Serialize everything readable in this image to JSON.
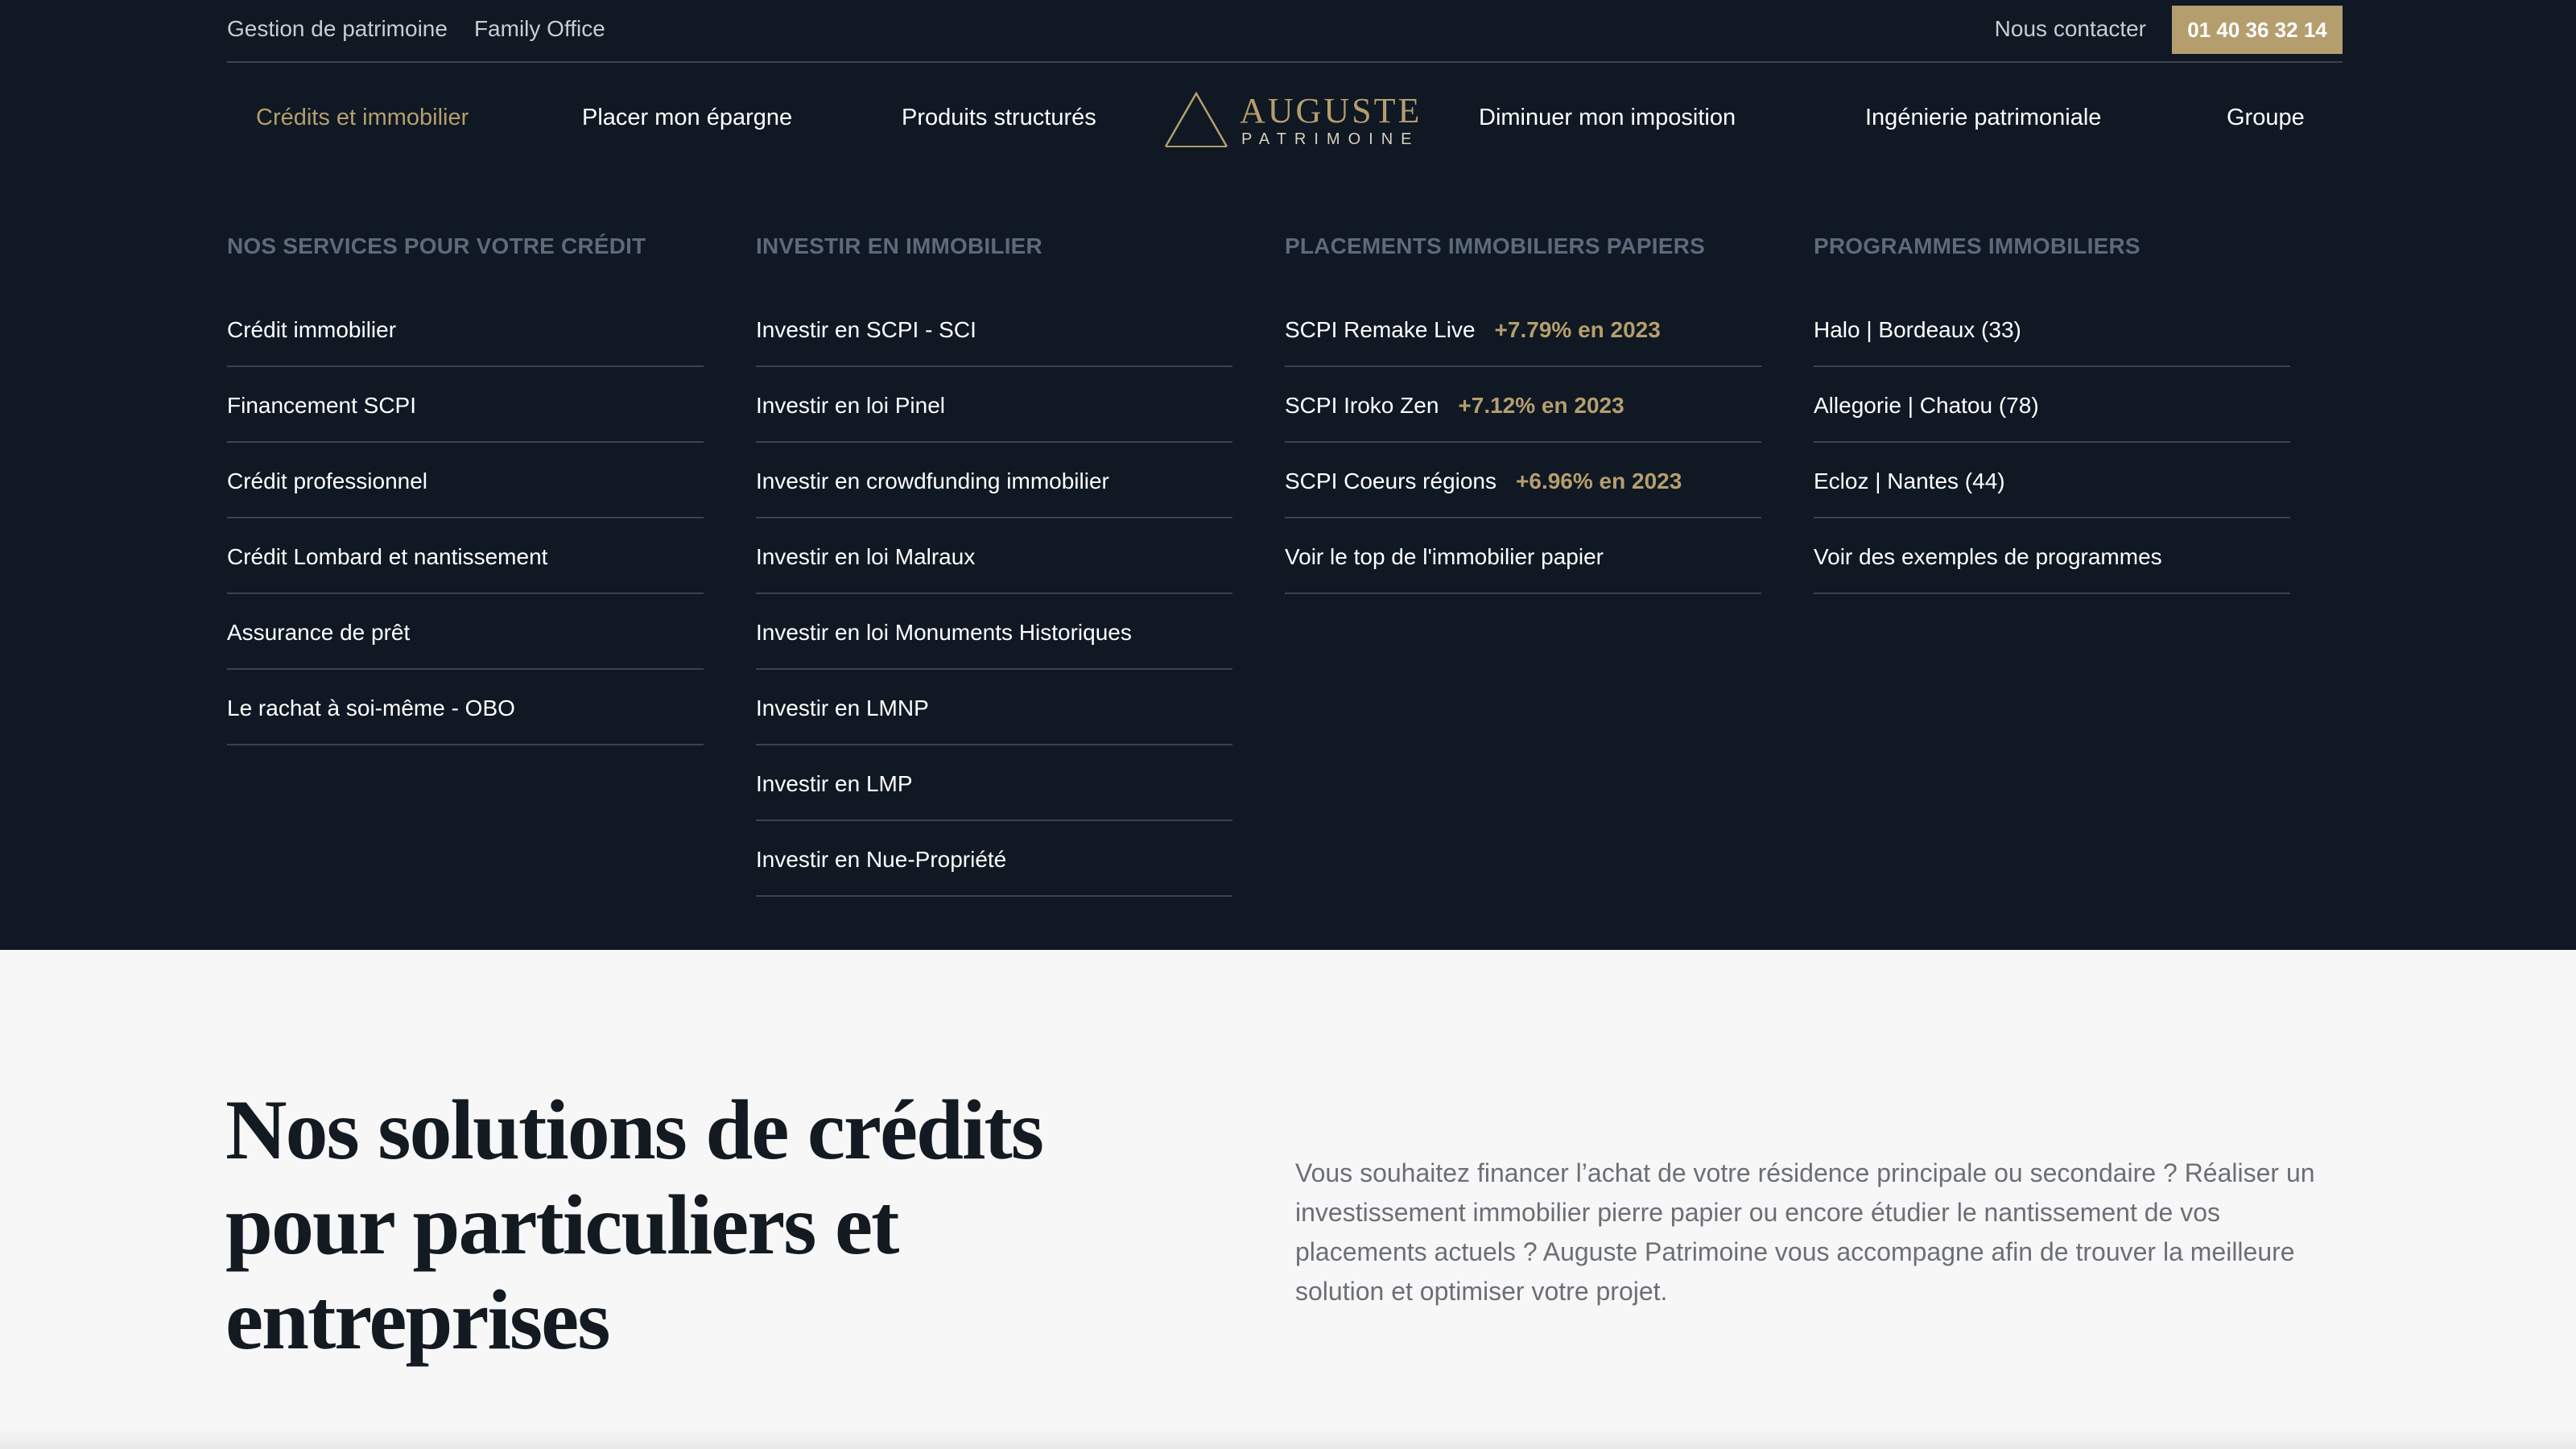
{
  "topbar": {
    "links": [
      "Gestion de patrimoine",
      "Family Office"
    ],
    "contact": "Nous contacter",
    "phone": "01 40 36 32 14"
  },
  "nav": {
    "items": [
      "Crédits et immobilier",
      "Placer mon épargne",
      "Produits structurés",
      "Diminuer mon imposition",
      "Ingénierie patrimoniale",
      "Groupe"
    ],
    "active_index": 0
  },
  "logo": {
    "name": "AUGUSTE",
    "sub": "PATRIMOINE"
  },
  "colors": {
    "dark_bg": "#0f1823",
    "gold": "#b59e6e",
    "light_bg": "#f7f7f8",
    "muted_heading": "#5c6a7c"
  },
  "menu": {
    "columns": [
      {
        "heading": "NOS SERVICES POUR VOTRE CRÉDIT",
        "items": [
          "Crédit immobilier",
          "Financement SCPI",
          "Crédit professionnel",
          "Crédit Lombard et nantissement",
          "Assurance de prêt",
          "Le rachat à soi-même - OBO"
        ]
      },
      {
        "heading": "INVESTIR EN IMMOBILIER",
        "items": [
          "Investir en SCPI - SCI",
          "Investir en loi Pinel",
          "Investir en crowdfunding immobilier",
          "Investir en loi Malraux",
          "Investir en loi Monuments Historiques",
          "Investir en LMNP",
          "Investir en LMP",
          "Investir en Nue-Propriété"
        ]
      },
      {
        "heading": "PLACEMENTS IMMOBILIERS PAPIERS",
        "items": [
          {
            "label": "SCPI Remake Live",
            "perf": "+7.79% en 2023"
          },
          {
            "label": "SCPI Iroko Zen",
            "perf": "+7.12% en 2023"
          },
          {
            "label": "SCPI Coeurs régions",
            "perf": "+6.96% en 2023"
          },
          {
            "label": "Voir le top de l'immobilier papier",
            "perf": ""
          }
        ]
      },
      {
        "heading": "PROGRAMMES IMMOBILIERS",
        "items": [
          "Halo | Bordeaux (33)",
          "Allegorie | Chatou (78)",
          "Ecloz | Nantes (44)",
          "Voir des exemples de programmes"
        ]
      }
    ]
  },
  "section": {
    "title": "Nos solutions de crédits pour particuliers et entreprises",
    "intro": "Vous souhaitez financer l’achat de votre résidence principale ou secondaire ? Réaliser un investissement immobilier pierre papier ou encore étudier le nantissement de vos placements actuels ? Auguste Patrimoine vous accompagne afin de trouver la meilleure solution et optimiser votre projet."
  }
}
